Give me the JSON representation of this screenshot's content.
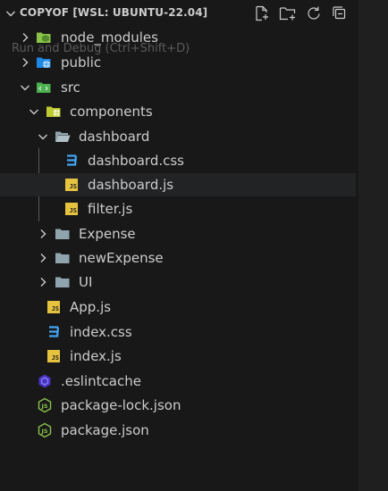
{
  "explorer": {
    "title": "COPYOF [WSL: UBUNTU-22.04]",
    "tooltip": "Run and Debug (Ctrl+Shift+D)",
    "actions": [
      "new-file-icon",
      "new-folder-icon",
      "refresh-icon",
      "collapse-all-icon"
    ]
  },
  "tree": [
    {
      "label": "node_modules",
      "kind": "folder",
      "expanded": false,
      "icon": "node-modules-folder-icon"
    },
    {
      "label": "public",
      "kind": "folder",
      "expanded": false,
      "icon": "public-folder-icon"
    },
    {
      "label": "src",
      "kind": "folder",
      "expanded": true,
      "icon": "src-folder-icon"
    },
    {
      "label": "components",
      "kind": "folder",
      "expanded": true,
      "icon": "components-folder-icon"
    },
    {
      "label": "dashboard",
      "kind": "folder",
      "expanded": true,
      "icon": "folder-open-icon"
    },
    {
      "label": "dashboard.css",
      "kind": "file",
      "icon": "css-file-icon"
    },
    {
      "label": "dashboard.js",
      "kind": "file",
      "icon": "js-file-icon",
      "selected": true
    },
    {
      "label": "filter.js",
      "kind": "file",
      "icon": "js-file-icon"
    },
    {
      "label": "Expense",
      "kind": "folder",
      "expanded": false,
      "icon": "folder-icon"
    },
    {
      "label": "newExpense",
      "kind": "folder",
      "expanded": false,
      "icon": "folder-icon"
    },
    {
      "label": "UI",
      "kind": "folder",
      "expanded": false,
      "icon": "folder-icon"
    },
    {
      "label": "App.js",
      "kind": "file",
      "icon": "js-file-icon"
    },
    {
      "label": "index.css",
      "kind": "file",
      "icon": "css-file-icon"
    },
    {
      "label": "index.js",
      "kind": "file",
      "icon": "js-file-icon"
    },
    {
      "label": ".eslintcache",
      "kind": "file",
      "icon": "eslint-icon"
    },
    {
      "label": "package-lock.json",
      "kind": "file",
      "icon": "nodejs-icon"
    },
    {
      "label": "package.json",
      "kind": "file",
      "icon": "nodejs-icon"
    }
  ],
  "colors": {
    "background": "#181818",
    "selected_row": "#222324",
    "js_badge": "#e6c33f",
    "css_icon": "#42a5f5",
    "folder": "#90a4ae",
    "node_green": "#8bc34a"
  },
  "js_badge_text": "JS"
}
